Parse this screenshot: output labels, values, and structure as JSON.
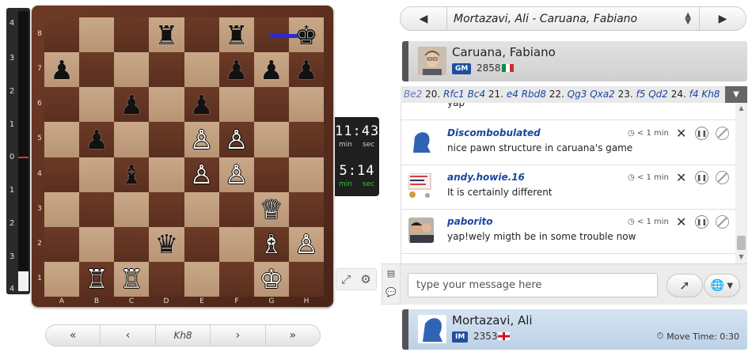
{
  "eval": {
    "labels": [
      "4",
      "3",
      "2",
      "1",
      "0",
      "1",
      "2",
      "3",
      "4"
    ],
    "white_fraction": 0.07
  },
  "board": {
    "files": [
      "A",
      "B",
      "C",
      "D",
      "E",
      "F",
      "G",
      "H"
    ],
    "ranks": [
      "8",
      "7",
      "6",
      "5",
      "4",
      "3",
      "2",
      "1"
    ],
    "pieces": {
      "d8": {
        "glyph": "♜",
        "color": "black",
        "piece": "black-rook"
      },
      "f8": {
        "glyph": "♜",
        "color": "black",
        "piece": "black-rook"
      },
      "h8": {
        "glyph": "♚",
        "color": "black",
        "piece": "black-king"
      },
      "a7": {
        "glyph": "♟",
        "color": "black",
        "piece": "black-pawn"
      },
      "f7": {
        "glyph": "♟",
        "color": "black",
        "piece": "black-pawn"
      },
      "g7": {
        "glyph": "♟",
        "color": "black",
        "piece": "black-pawn"
      },
      "h7": {
        "glyph": "♟",
        "color": "black",
        "piece": "black-pawn"
      },
      "c6": {
        "glyph": "♟",
        "color": "black",
        "piece": "black-pawn"
      },
      "e6": {
        "glyph": "♟",
        "color": "black",
        "piece": "black-pawn"
      },
      "b5": {
        "glyph": "♟",
        "color": "black",
        "piece": "black-pawn"
      },
      "e5": {
        "glyph": "♙",
        "color": "white",
        "piece": "white-pawn"
      },
      "f5": {
        "glyph": "♙",
        "color": "white",
        "piece": "white-pawn"
      },
      "c4": {
        "glyph": "♝",
        "color": "black",
        "piece": "black-bishop"
      },
      "e4": {
        "glyph": "♙",
        "color": "white",
        "piece": "white-pawn"
      },
      "f4": {
        "glyph": "♙",
        "color": "white",
        "piece": "white-pawn"
      },
      "g3": {
        "glyph": "♕",
        "color": "white",
        "piece": "white-queen"
      },
      "d2": {
        "glyph": "♛",
        "color": "black",
        "piece": "black-queen"
      },
      "g2": {
        "glyph": "♗",
        "color": "white",
        "piece": "white-bishop"
      },
      "h2": {
        "glyph": "♙",
        "color": "white",
        "piece": "white-pawn"
      },
      "b1": {
        "glyph": "♖",
        "color": "white",
        "piece": "white-rook"
      },
      "c1": {
        "glyph": "♖",
        "color": "white",
        "piece": "white-rook"
      },
      "g1": {
        "glyph": "♔",
        "color": "white",
        "piece": "white-king"
      }
    },
    "arrow_color": "#2a2ad8"
  },
  "clock": {
    "top": {
      "time": "11:43",
      "min_label": "min",
      "sec_label": "sec"
    },
    "bottom": {
      "time": "5:14",
      "min_label": "min",
      "sec_label": "sec"
    }
  },
  "tools": {
    "fullscreen_icon": "expand-icon",
    "settings_icon": "gear-icon"
  },
  "nav": {
    "first": "«",
    "prev": "‹",
    "current_move": "Kh8",
    "next": "›",
    "last": "»"
  },
  "game_selector": {
    "prev": "◀",
    "title": "Mortazavi, Ali - Caruana, Fabiano",
    "next": "▶"
  },
  "top_player": {
    "name": "Caruana, Fabiano",
    "title": "GM",
    "rating": "2858",
    "country": "Italy"
  },
  "bottom_player": {
    "name": "Mortazavi, Ali",
    "title": "IM",
    "rating": "2353",
    "country": "England",
    "move_time_label": "Move Time: 0:30"
  },
  "moves": {
    "items": [
      {
        "n": "",
        "m": "Be2"
      },
      {
        "n": "20.",
        "m": "Rfc1"
      },
      {
        "n": "",
        "m": "Bc4"
      },
      {
        "n": "21.",
        "m": "e4"
      },
      {
        "n": "",
        "m": "Rbd8"
      },
      {
        "n": "22.",
        "m": "Qg3"
      },
      {
        "n": "",
        "m": "Qxa2"
      },
      {
        "n": "23.",
        "m": "f5"
      },
      {
        "n": "",
        "m": "Qd2"
      },
      {
        "n": "24.",
        "m": "f4"
      },
      {
        "n": "",
        "m": "Kh8"
      }
    ]
  },
  "chat": {
    "partial_text": "yap",
    "messages": [
      {
        "user": "Discombobulated",
        "text": "nice pawn structure in caruana's game",
        "time": "< 1 min"
      },
      {
        "user": "andy.howie.16",
        "text": "It is certainly different",
        "time": "< 1 min"
      },
      {
        "user": "paborito",
        "text": "yap!wely migth be in some trouble now",
        "time": "< 1 min"
      }
    ],
    "placeholder": "type your message here"
  },
  "colors": {
    "accent": "#1a46a0",
    "title_badge": "#1e4f9e",
    "bottom_card": "#c8d8ea"
  }
}
